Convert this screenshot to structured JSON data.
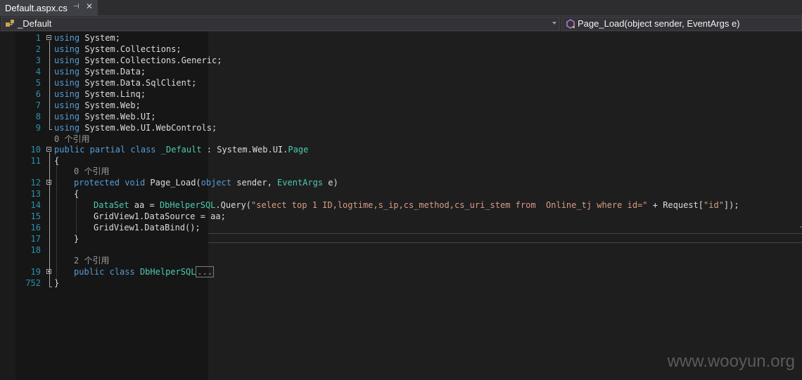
{
  "tab": {
    "title": "Default.aspx.cs",
    "pin_glyph": "⊣",
    "close_glyph": "✕"
  },
  "navbar": {
    "class_combo": "_Default",
    "member_combo": "Page_Load(object sender, EventArgs e)"
  },
  "gutter": [
    "1",
    "2",
    "3",
    "4",
    "5",
    "6",
    "7",
    "8",
    "9",
    "10",
    "11",
    "12",
    "13",
    "14",
    "15",
    "16",
    "17",
    "18",
    "19",
    "752"
  ],
  "code": {
    "l1": [
      "using",
      " System;"
    ],
    "l2": [
      "using",
      " System.Collections;"
    ],
    "l3": [
      "using",
      " System.Collections.Generic;"
    ],
    "l4": [
      "using",
      " System.Data;"
    ],
    "l5": [
      "using",
      " System.Data.SqlClient;"
    ],
    "l6": [
      "using",
      " System.Linq;"
    ],
    "l7": [
      "using",
      " System.Web;"
    ],
    "l8": [
      "using",
      " System.Web.UI;"
    ],
    "l9": [
      "using",
      " System.Web.UI.WebControls;"
    ],
    "ref_class": "0 个引用",
    "l10": [
      "public",
      " ",
      "partial",
      " ",
      "class",
      " ",
      "_Default",
      " : System.Web.UI.",
      "Page"
    ],
    "l11": "{",
    "ref_method": "0 个引用",
    "l12": [
      "protected",
      " ",
      "void",
      " Page_Load(",
      "object",
      " sender, ",
      "EventArgs",
      " e)"
    ],
    "l13": "{",
    "l14": [
      "DataSet",
      " aa = ",
      "DbHelperSQL",
      ".Query(",
      "\"select top 1 ID,logtime,s_ip,cs_method,cs_uri_stem from  Online_tj where id=\"",
      " + Request[",
      "\"id\"",
      "]);"
    ],
    "l15": "GridView1.DataSource = aa;",
    "l16": "GridView1.DataBind();",
    "l17": "}",
    "ref_helper": "2 个引用",
    "l19": [
      "public",
      " ",
      "class",
      " ",
      "DbHelperSQL",
      "..."
    ],
    "l752": "}"
  },
  "watermark": "www.wooyun.org",
  "colors": {
    "keyword": "#569cd6",
    "type": "#4ec9b0",
    "string": "#d69d85",
    "line_number": "#2b91af",
    "text": "#dcdcdc",
    "background": "#1e1e1e"
  }
}
